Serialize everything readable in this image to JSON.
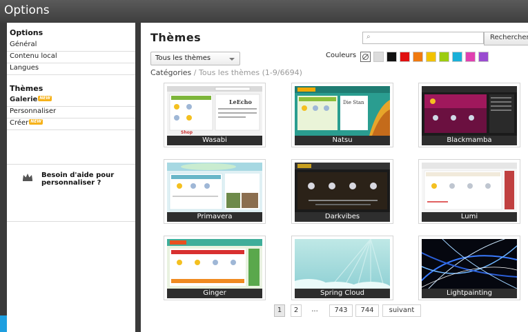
{
  "window": {
    "title": "Options"
  },
  "sidebar": {
    "options_heading": "Options",
    "options_items": [
      "Général",
      "Contenu local",
      "Langues"
    ],
    "themes_heading": "Thèmes",
    "themes_items": [
      {
        "label": "Galerie",
        "badge": "NEW"
      },
      {
        "label": "Personnaliser",
        "badge": ""
      },
      {
        "label": "Créer",
        "badge": "NEW"
      }
    ],
    "help_text": "Besoin d'aide pour personnaliser ?"
  },
  "main": {
    "title": "Thèmes",
    "search": {
      "placeholder": "",
      "button_label": "Rechercher"
    },
    "filter": {
      "selected": "Tous les thèmes"
    },
    "colors_label": "Couleurs",
    "colors": [
      "#dcdcdc",
      "#111111",
      "#e01010",
      "#f07a10",
      "#f2c200",
      "#9ccc10",
      "#1ab0d8",
      "#e040b0",
      "#9a4cd0"
    ],
    "breadcrumb": {
      "root": "Catégories",
      "separator": "/",
      "current": "Tous les thèmes (1-9/6694)"
    },
    "themes": [
      {
        "name": "Wasabi"
      },
      {
        "name": "Natsu"
      },
      {
        "name": "Blackmamba"
      },
      {
        "name": "Primavera"
      },
      {
        "name": "Darkvibes"
      },
      {
        "name": "Lumi"
      },
      {
        "name": "Ginger"
      },
      {
        "name": "Spring Cloud"
      },
      {
        "name": "Lightpainting"
      }
    ],
    "pagination": {
      "pages": [
        "1",
        "2",
        "...",
        "743",
        "744"
      ],
      "current": "1",
      "next_label": "suivant"
    }
  }
}
